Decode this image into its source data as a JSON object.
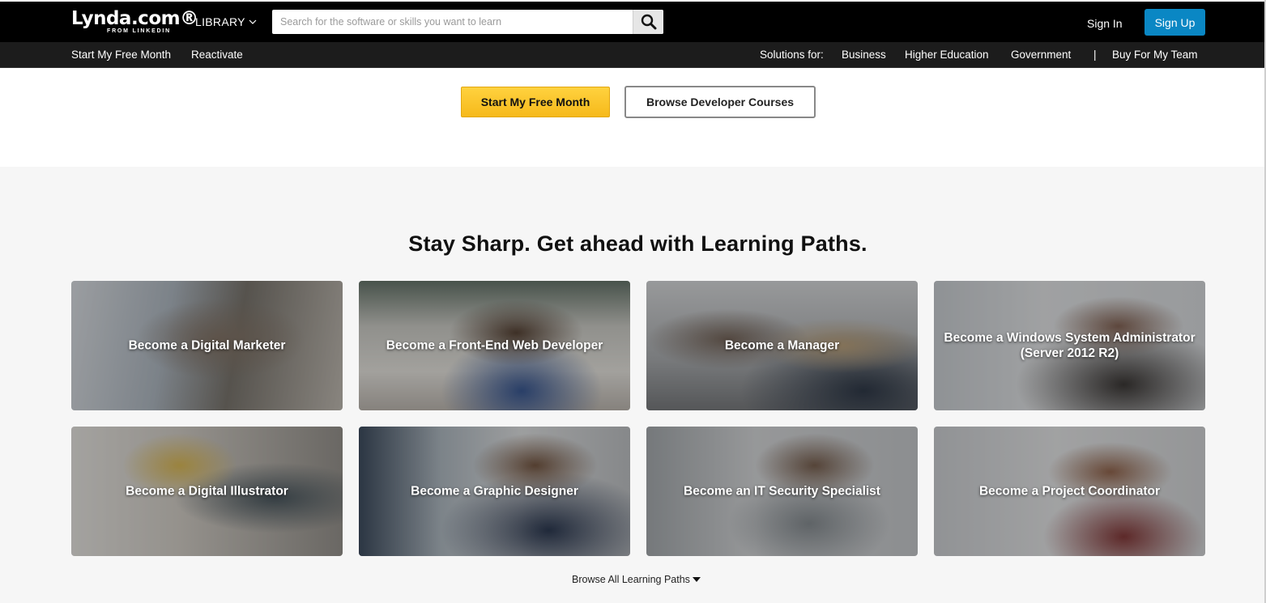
{
  "topbar": {
    "logo_main": "Lynda.com®",
    "logo_sub": "FROM LINKEDIN",
    "library_label": "LIBRARY",
    "search": {
      "placeholder": "Search for the software or skills you want to learn",
      "value": ""
    },
    "signin_label": "Sign In",
    "signup_label": "Sign Up"
  },
  "subbar": {
    "left": [
      "Start My Free Month",
      "Reactivate"
    ],
    "solutions_label": "Solutions for:",
    "solutions": [
      "Business",
      "Higher Education",
      "Government"
    ],
    "separator": "|",
    "buy_team": "Buy For My Team"
  },
  "cta": {
    "primary_label": "Start My Free Month",
    "secondary_label": "Browse Developer Courses"
  },
  "paths": {
    "title": "Stay Sharp. Get ahead with Learning Paths.",
    "cards": [
      {
        "label": "Become a Digital Marketer"
      },
      {
        "label": "Become a Front-End Web Developer"
      },
      {
        "label": "Become a Manager"
      },
      {
        "label": "Become a Windows System Administrator (Server 2012 R2)"
      },
      {
        "label": "Become a Digital Illustrator"
      },
      {
        "label": "Become a Graphic Designer"
      },
      {
        "label": "Become an IT Security Specialist"
      },
      {
        "label": "Become a Project Coordinator"
      }
    ],
    "browse_all_label": "Browse All Learning Paths"
  },
  "colors": {
    "topbar_bg": "#000000",
    "subbar_bg": "#1c1c1c",
    "signup_bg": "#0a87c4",
    "primary_btn": "#f6b91a",
    "section_bg": "#f6f6f6"
  }
}
